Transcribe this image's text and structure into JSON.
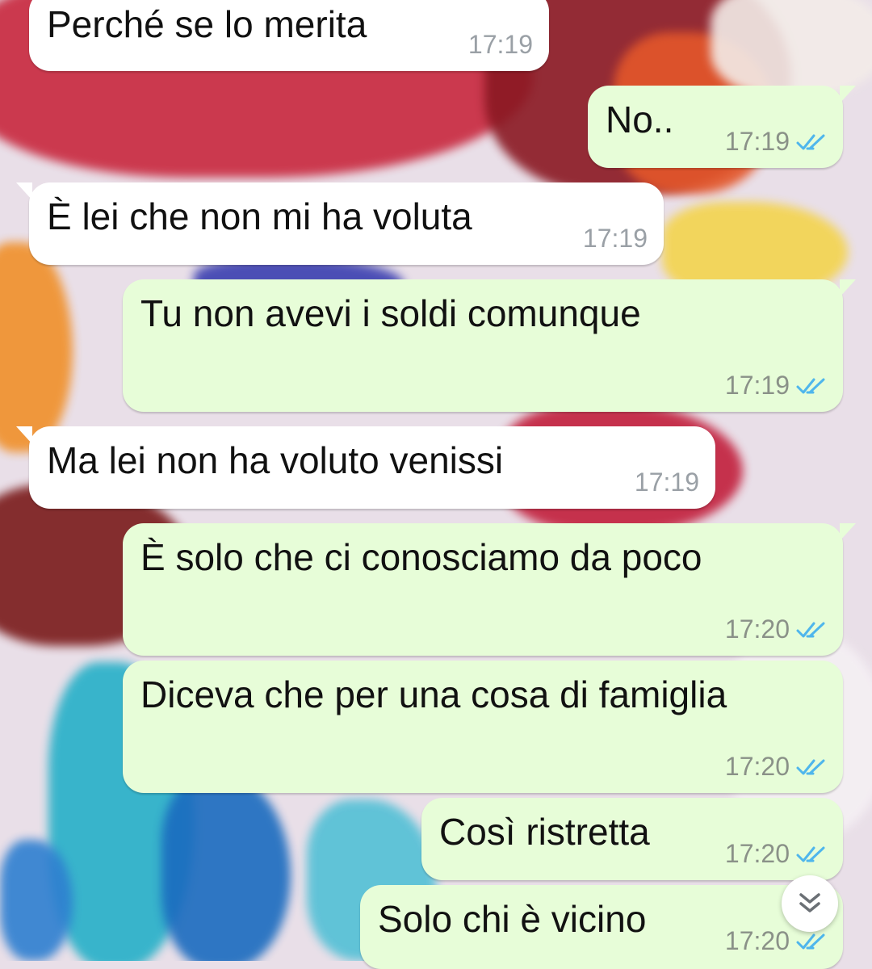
{
  "chat": {
    "messages": [
      {
        "direction": "incoming",
        "text": "Perché se lo merita",
        "time": "17:19"
      },
      {
        "direction": "outgoing",
        "text": "No..",
        "time": "17:19",
        "status": "read"
      },
      {
        "direction": "incoming",
        "text": "È lei che non mi ha voluta",
        "time": "17:19"
      },
      {
        "direction": "outgoing",
        "text": "Tu non avevi i soldi comunque",
        "time": "17:19",
        "status": "read"
      },
      {
        "direction": "incoming",
        "text": "Ma lei non ha voluto venissi",
        "time": "17:19"
      },
      {
        "direction": "outgoing",
        "text": "È solo che ci conosciamo da poco",
        "time": "17:20",
        "status": "read"
      },
      {
        "direction": "outgoing",
        "text": "Diceva che per una cosa di famiglia",
        "time": "17:20",
        "status": "read"
      },
      {
        "direction": "outgoing",
        "text": "Così ristretta",
        "time": "17:20",
        "status": "read"
      },
      {
        "direction": "outgoing",
        "text": "Solo chi è vicino",
        "time": "17:20",
        "status": "read"
      }
    ]
  },
  "colors": {
    "incoming_bubble": "#ffffff",
    "outgoing_bubble": "#e7fdd8",
    "read_ticks": "#4fb6ec"
  },
  "icons": {
    "read_status": "double-check-icon",
    "scroll_down": "double-chevron-down-icon"
  }
}
